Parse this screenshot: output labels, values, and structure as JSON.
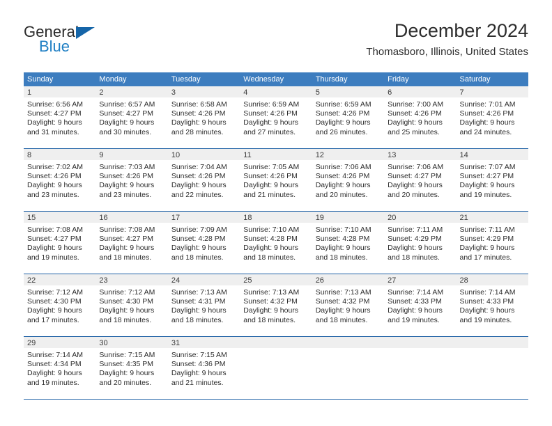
{
  "logo": {
    "word_top": "General",
    "word_bottom": "Blue",
    "triangle": "triangle-logo-mark"
  },
  "header": {
    "title": "December 2024",
    "location": "Thomasboro, Illinois, United States"
  },
  "colors": {
    "header_blue": "#3d7dbf",
    "rule_blue": "#1f61a5",
    "logo_blue": "#1f7fc4",
    "daynum_gray": "#efefef"
  },
  "weekdays": [
    "Sunday",
    "Monday",
    "Tuesday",
    "Wednesday",
    "Thursday",
    "Friday",
    "Saturday"
  ],
  "weeks": [
    [
      {
        "day": "1",
        "sunrise": "Sunrise: 6:56 AM",
        "sunset": "Sunset: 4:27 PM",
        "daylight1": "Daylight: 9 hours",
        "daylight2": "and 31 minutes."
      },
      {
        "day": "2",
        "sunrise": "Sunrise: 6:57 AM",
        "sunset": "Sunset: 4:27 PM",
        "daylight1": "Daylight: 9 hours",
        "daylight2": "and 30 minutes."
      },
      {
        "day": "3",
        "sunrise": "Sunrise: 6:58 AM",
        "sunset": "Sunset: 4:26 PM",
        "daylight1": "Daylight: 9 hours",
        "daylight2": "and 28 minutes."
      },
      {
        "day": "4",
        "sunrise": "Sunrise: 6:59 AM",
        "sunset": "Sunset: 4:26 PM",
        "daylight1": "Daylight: 9 hours",
        "daylight2": "and 27 minutes."
      },
      {
        "day": "5",
        "sunrise": "Sunrise: 6:59 AM",
        "sunset": "Sunset: 4:26 PM",
        "daylight1": "Daylight: 9 hours",
        "daylight2": "and 26 minutes."
      },
      {
        "day": "6",
        "sunrise": "Sunrise: 7:00 AM",
        "sunset": "Sunset: 4:26 PM",
        "daylight1": "Daylight: 9 hours",
        "daylight2": "and 25 minutes."
      },
      {
        "day": "7",
        "sunrise": "Sunrise: 7:01 AM",
        "sunset": "Sunset: 4:26 PM",
        "daylight1": "Daylight: 9 hours",
        "daylight2": "and 24 minutes."
      }
    ],
    [
      {
        "day": "8",
        "sunrise": "Sunrise: 7:02 AM",
        "sunset": "Sunset: 4:26 PM",
        "daylight1": "Daylight: 9 hours",
        "daylight2": "and 23 minutes."
      },
      {
        "day": "9",
        "sunrise": "Sunrise: 7:03 AM",
        "sunset": "Sunset: 4:26 PM",
        "daylight1": "Daylight: 9 hours",
        "daylight2": "and 23 minutes."
      },
      {
        "day": "10",
        "sunrise": "Sunrise: 7:04 AM",
        "sunset": "Sunset: 4:26 PM",
        "daylight1": "Daylight: 9 hours",
        "daylight2": "and 22 minutes."
      },
      {
        "day": "11",
        "sunrise": "Sunrise: 7:05 AM",
        "sunset": "Sunset: 4:26 PM",
        "daylight1": "Daylight: 9 hours",
        "daylight2": "and 21 minutes."
      },
      {
        "day": "12",
        "sunrise": "Sunrise: 7:06 AM",
        "sunset": "Sunset: 4:26 PM",
        "daylight1": "Daylight: 9 hours",
        "daylight2": "and 20 minutes."
      },
      {
        "day": "13",
        "sunrise": "Sunrise: 7:06 AM",
        "sunset": "Sunset: 4:27 PM",
        "daylight1": "Daylight: 9 hours",
        "daylight2": "and 20 minutes."
      },
      {
        "day": "14",
        "sunrise": "Sunrise: 7:07 AM",
        "sunset": "Sunset: 4:27 PM",
        "daylight1": "Daylight: 9 hours",
        "daylight2": "and 19 minutes."
      }
    ],
    [
      {
        "day": "15",
        "sunrise": "Sunrise: 7:08 AM",
        "sunset": "Sunset: 4:27 PM",
        "daylight1": "Daylight: 9 hours",
        "daylight2": "and 19 minutes."
      },
      {
        "day": "16",
        "sunrise": "Sunrise: 7:08 AM",
        "sunset": "Sunset: 4:27 PM",
        "daylight1": "Daylight: 9 hours",
        "daylight2": "and 18 minutes."
      },
      {
        "day": "17",
        "sunrise": "Sunrise: 7:09 AM",
        "sunset": "Sunset: 4:28 PM",
        "daylight1": "Daylight: 9 hours",
        "daylight2": "and 18 minutes."
      },
      {
        "day": "18",
        "sunrise": "Sunrise: 7:10 AM",
        "sunset": "Sunset: 4:28 PM",
        "daylight1": "Daylight: 9 hours",
        "daylight2": "and 18 minutes."
      },
      {
        "day": "19",
        "sunrise": "Sunrise: 7:10 AM",
        "sunset": "Sunset: 4:28 PM",
        "daylight1": "Daylight: 9 hours",
        "daylight2": "and 18 minutes."
      },
      {
        "day": "20",
        "sunrise": "Sunrise: 7:11 AM",
        "sunset": "Sunset: 4:29 PM",
        "daylight1": "Daylight: 9 hours",
        "daylight2": "and 18 minutes."
      },
      {
        "day": "21",
        "sunrise": "Sunrise: 7:11 AM",
        "sunset": "Sunset: 4:29 PM",
        "daylight1": "Daylight: 9 hours",
        "daylight2": "and 17 minutes."
      }
    ],
    [
      {
        "day": "22",
        "sunrise": "Sunrise: 7:12 AM",
        "sunset": "Sunset: 4:30 PM",
        "daylight1": "Daylight: 9 hours",
        "daylight2": "and 17 minutes."
      },
      {
        "day": "23",
        "sunrise": "Sunrise: 7:12 AM",
        "sunset": "Sunset: 4:30 PM",
        "daylight1": "Daylight: 9 hours",
        "daylight2": "and 18 minutes."
      },
      {
        "day": "24",
        "sunrise": "Sunrise: 7:13 AM",
        "sunset": "Sunset: 4:31 PM",
        "daylight1": "Daylight: 9 hours",
        "daylight2": "and 18 minutes."
      },
      {
        "day": "25",
        "sunrise": "Sunrise: 7:13 AM",
        "sunset": "Sunset: 4:32 PM",
        "daylight1": "Daylight: 9 hours",
        "daylight2": "and 18 minutes."
      },
      {
        "day": "26",
        "sunrise": "Sunrise: 7:13 AM",
        "sunset": "Sunset: 4:32 PM",
        "daylight1": "Daylight: 9 hours",
        "daylight2": "and 18 minutes."
      },
      {
        "day": "27",
        "sunrise": "Sunrise: 7:14 AM",
        "sunset": "Sunset: 4:33 PM",
        "daylight1": "Daylight: 9 hours",
        "daylight2": "and 19 minutes."
      },
      {
        "day": "28",
        "sunrise": "Sunrise: 7:14 AM",
        "sunset": "Sunset: 4:33 PM",
        "daylight1": "Daylight: 9 hours",
        "daylight2": "and 19 minutes."
      }
    ],
    [
      {
        "day": "29",
        "sunrise": "Sunrise: 7:14 AM",
        "sunset": "Sunset: 4:34 PM",
        "daylight1": "Daylight: 9 hours",
        "daylight2": "and 19 minutes."
      },
      {
        "day": "30",
        "sunrise": "Sunrise: 7:15 AM",
        "sunset": "Sunset: 4:35 PM",
        "daylight1": "Daylight: 9 hours",
        "daylight2": "and 20 minutes."
      },
      {
        "day": "31",
        "sunrise": "Sunrise: 7:15 AM",
        "sunset": "Sunset: 4:36 PM",
        "daylight1": "Daylight: 9 hours",
        "daylight2": "and 21 minutes."
      },
      {
        "day": "",
        "sunrise": "",
        "sunset": "",
        "daylight1": "",
        "daylight2": ""
      },
      {
        "day": "",
        "sunrise": "",
        "sunset": "",
        "daylight1": "",
        "daylight2": ""
      },
      {
        "day": "",
        "sunrise": "",
        "sunset": "",
        "daylight1": "",
        "daylight2": ""
      },
      {
        "day": "",
        "sunrise": "",
        "sunset": "",
        "daylight1": "",
        "daylight2": ""
      }
    ]
  ]
}
